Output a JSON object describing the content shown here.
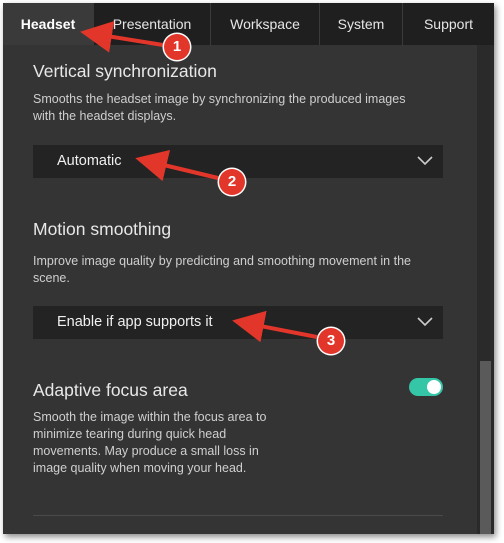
{
  "tabs": [
    {
      "label": "Headset",
      "active": true
    },
    {
      "label": "Presentation",
      "active": false
    },
    {
      "label": "Workspace",
      "active": false
    },
    {
      "label": "System",
      "active": false
    },
    {
      "label": "Support",
      "active": false
    }
  ],
  "vsync": {
    "title": "Vertical synchronization",
    "desc_line1": "Smooths the headset image by synchronizing the produced images",
    "desc_line2": "with the headset displays.",
    "value": "Automatic"
  },
  "motion": {
    "title": "Motion smoothing",
    "desc_line1": "Improve image quality by predicting and smoothing movement in the",
    "desc_line2": "scene.",
    "value": "Enable if app supports it"
  },
  "focus": {
    "title": "Adaptive focus area",
    "desc_line1": "Smooth the image within the focus area to",
    "desc_line2": "minimize tearing during quick head",
    "desc_line3": "movements. May produce a small loss in",
    "desc_line4": "image quality when moving your head.",
    "toggle_on": true
  },
  "annotations": [
    {
      "number": "1"
    },
    {
      "number": "2"
    },
    {
      "number": "3"
    }
  ],
  "colors": {
    "accent": "#35c6a8",
    "annotation": "#e2362b",
    "background": "#343434"
  }
}
